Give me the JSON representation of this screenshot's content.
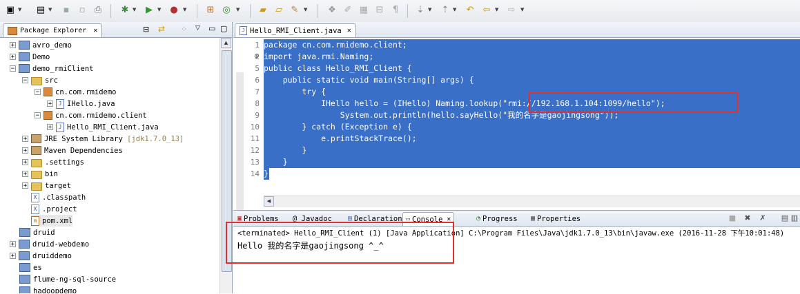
{
  "toolbar": {
    "icons": [
      "new-icon",
      "new-wizard-icon",
      "save-icon",
      "save-all-icon",
      "print-icon",
      "debug-icon",
      "run-icon",
      "external-tools-icon",
      "new-java-package-icon",
      "new-java-class-icon",
      "open-type-icon",
      "open-folder-icon",
      "search-icon",
      "toggle-annotation-icon",
      "mark-occurrences-icon",
      "show-whitespace-icon",
      "paragraph-icon",
      "next-annotation-icon",
      "prev-annotation-icon",
      "last-edit-icon",
      "back-icon",
      "forward-icon"
    ]
  },
  "package_explorer": {
    "tab_label": "Package Explorer",
    "items": [
      {
        "label": "avro_demo",
        "decor": ""
      },
      {
        "label": "Demo",
        "decor": ""
      },
      {
        "label": "demo_rmiClient",
        "decor": ""
      },
      {
        "label": "src",
        "decor": ""
      },
      {
        "label": "cn.com.rmidemo",
        "decor": ""
      },
      {
        "label": "IHello.java",
        "decor": ""
      },
      {
        "label": "cn.com.rmidemo.client",
        "decor": ""
      },
      {
        "label": "Hello_RMI_Client.java",
        "decor": ""
      },
      {
        "label": "JRE System Library",
        "decor": "[jdk1.7.0_13]"
      },
      {
        "label": "Maven Dependencies",
        "decor": ""
      },
      {
        "label": ".settings",
        "decor": ""
      },
      {
        "label": "bin",
        "decor": ""
      },
      {
        "label": "target",
        "decor": ""
      },
      {
        "label": ".classpath",
        "decor": ""
      },
      {
        "label": ".project",
        "decor": ""
      },
      {
        "label": "pom.xml",
        "decor": ""
      },
      {
        "label": "druid",
        "decor": ""
      },
      {
        "label": "druid-webdemo",
        "decor": ""
      },
      {
        "label": "druiddemo",
        "decor": ""
      },
      {
        "label": "es",
        "decor": ""
      },
      {
        "label": "flume-ng-sql-source",
        "decor": ""
      },
      {
        "label": "hadoopdemo",
        "decor": ""
      }
    ]
  },
  "editor": {
    "tab_label": "Hello_RMI_Client.java",
    "line_numbers": [
      "1",
      "2",
      "5",
      "6",
      "7",
      "8",
      "9",
      "10",
      "11",
      "12",
      "13",
      "14"
    ],
    "lines": [
      "package cn.com.rmidemo.client;",
      "import java.rmi.Naming;",
      "public class Hello_RMI_Client {",
      "    public static void main(String[] args) {",
      "        try {",
      "            IHello hello = (IHello) Naming.lookup(\"rmi://192.168.1.104:1099/hello\");",
      "                System.out.println(hello.sayHello(\"我的名字是gaojingsong\"));",
      "        } catch (Exception e) {",
      "            e.printStackTrace();",
      "        }",
      "    }",
      "}"
    ]
  },
  "console": {
    "tabs": [
      "Problems",
      "@ Javadoc",
      "Declaration",
      "Console",
      "Progress",
      "Properties"
    ],
    "status_line": "<terminated> Hello_RMI_Client (1) [Java Application] C:\\Program Files\\Java\\jdk1.7.0_13\\bin\\javaw.exe (2016-11-28 下午10:01:48)",
    "output": "Hello 我的名字是gaojingsong ^_^"
  },
  "colors": {
    "selection": "#3a6fc8",
    "highlight_box": "#e23030"
  }
}
